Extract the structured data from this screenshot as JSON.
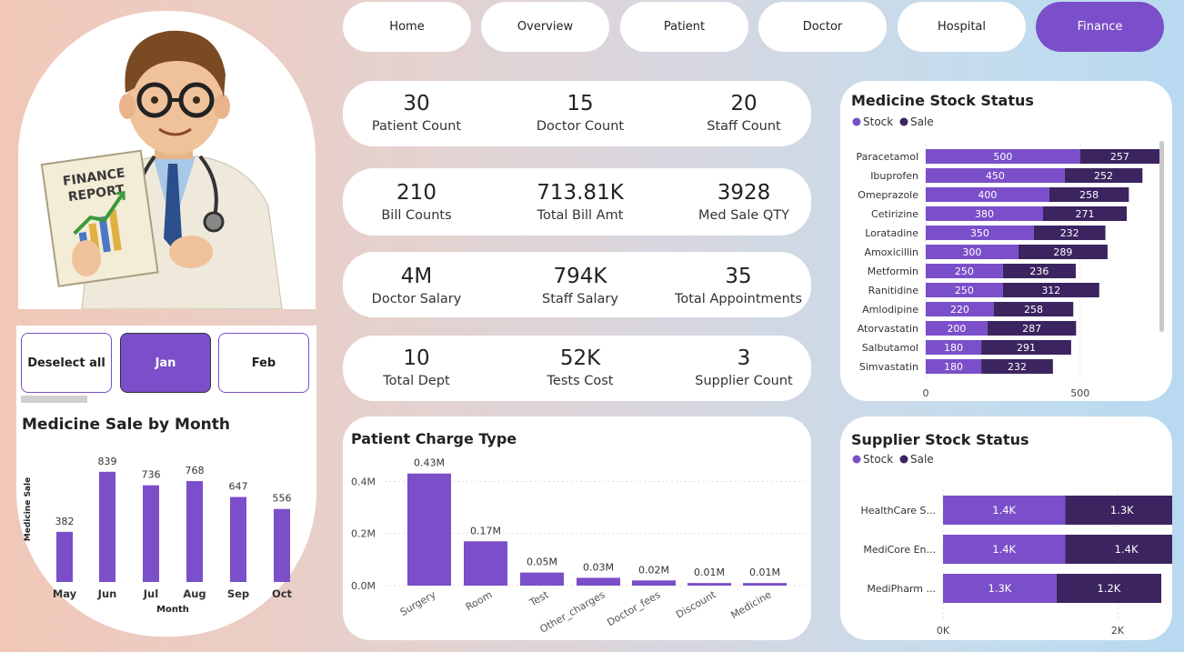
{
  "nav": [
    {
      "label": "Home",
      "active": false
    },
    {
      "label": "Overview",
      "active": false
    },
    {
      "label": "Patient",
      "active": false
    },
    {
      "label": "Doctor",
      "active": false
    },
    {
      "label": "Hospital",
      "active": false
    },
    {
      "label": "Finance",
      "active": true
    }
  ],
  "illustration": {
    "report_line1": "FINANCE",
    "report_line2": "REPORT"
  },
  "slicer": {
    "deselect": "Deselect all",
    "jan": "Jan",
    "feb": "Feb"
  },
  "kpis": [
    [
      {
        "value": "30",
        "label": "Patient Count"
      },
      {
        "value": "15",
        "label": "Doctor Count"
      },
      {
        "value": "20",
        "label": "Staff Count"
      }
    ],
    [
      {
        "value": "210",
        "label": "Bill Counts"
      },
      {
        "value": "713.81K",
        "label": "Total Bill Amt"
      },
      {
        "value": "3928",
        "label": "Med Sale QTY"
      }
    ],
    [
      {
        "value": "4M",
        "label": "Doctor Salary"
      },
      {
        "value": "794K",
        "label": "Staff Salary"
      },
      {
        "value": "35",
        "label": "Total Appointments"
      }
    ],
    [
      {
        "value": "10",
        "label": "Total Dept"
      },
      {
        "value": "52K",
        "label": "Tests Cost"
      },
      {
        "value": "3",
        "label": "Supplier Count"
      }
    ]
  ],
  "colors": {
    "accent": "#7a4fc9",
    "stock": "#7a4fc9",
    "sale": "#3b2460"
  },
  "chart_data": [
    {
      "id": "medicine_sale_by_month",
      "type": "bar",
      "title": "Medicine Sale by Month",
      "xlabel": "Month",
      "ylabel": "Medicine Sale",
      "categories": [
        "May",
        "Jun",
        "Jul",
        "Aug",
        "Sep",
        "Oct"
      ],
      "values": [
        382,
        839,
        736,
        768,
        647,
        556
      ]
    },
    {
      "id": "patient_charge_type",
      "type": "bar",
      "title": "Patient Charge Type",
      "categories": [
        "Surgery",
        "Room",
        "Test",
        "Other_charges",
        "Doctor_fees",
        "Discount",
        "Medicine"
      ],
      "values": [
        0.43,
        0.17,
        0.05,
        0.03,
        0.02,
        0.01,
        0.01
      ],
      "value_labels": [
        "0.43M",
        "0.17M",
        "0.05M",
        "0.03M",
        "0.02M",
        "0.01M",
        "0.01M"
      ],
      "yticks": [
        "0.0M",
        "0.2M",
        "0.4M"
      ],
      "ytick_values": [
        0,
        0.2,
        0.4
      ],
      "ylim": [
        0,
        0.45
      ]
    },
    {
      "id": "medicine_stock_status",
      "type": "bar",
      "orientation": "horizontal",
      "stacked": true,
      "title": "Medicine Stock Status",
      "categories": [
        "Paracetamol",
        "Ibuprofen",
        "Omeprazole",
        "Cetirizine",
        "Loratadine",
        "Amoxicillin",
        "Metformin",
        "Ranitidine",
        "Amlodipine",
        "Atorvastatin",
        "Salbutamol",
        "Simvastatin"
      ],
      "series": [
        {
          "name": "Stock",
          "values": [
            500,
            450,
            400,
            380,
            350,
            300,
            250,
            250,
            220,
            200,
            180,
            180
          ]
        },
        {
          "name": "Sale",
          "values": [
            257,
            252,
            258,
            271,
            232,
            289,
            236,
            312,
            258,
            287,
            291,
            232
          ]
        }
      ],
      "xticks": [
        "0",
        "500"
      ],
      "xtick_values": [
        0,
        500
      ],
      "xlim": [
        0,
        760
      ],
      "legend": "top-left"
    },
    {
      "id": "supplier_stock_status",
      "type": "bar",
      "orientation": "horizontal",
      "stacked": true,
      "title": "Supplier Stock Status",
      "categories": [
        "HealthCare S...",
        "MediCore En...",
        "MediPharm ..."
      ],
      "series": [
        {
          "name": "Stock",
          "values": [
            1400,
            1400,
            1300
          ],
          "labels": [
            "1.4K",
            "1.4K",
            "1.3K"
          ]
        },
        {
          "name": "Sale",
          "values": [
            1300,
            1400,
            1200
          ],
          "labels": [
            "1.3K",
            "1.4K",
            "1.2K"
          ]
        }
      ],
      "xticks": [
        "0K",
        "2K"
      ],
      "xtick_values": [
        0,
        2000
      ],
      "xlim": [
        0,
        2750
      ],
      "legend": "top-left"
    }
  ]
}
